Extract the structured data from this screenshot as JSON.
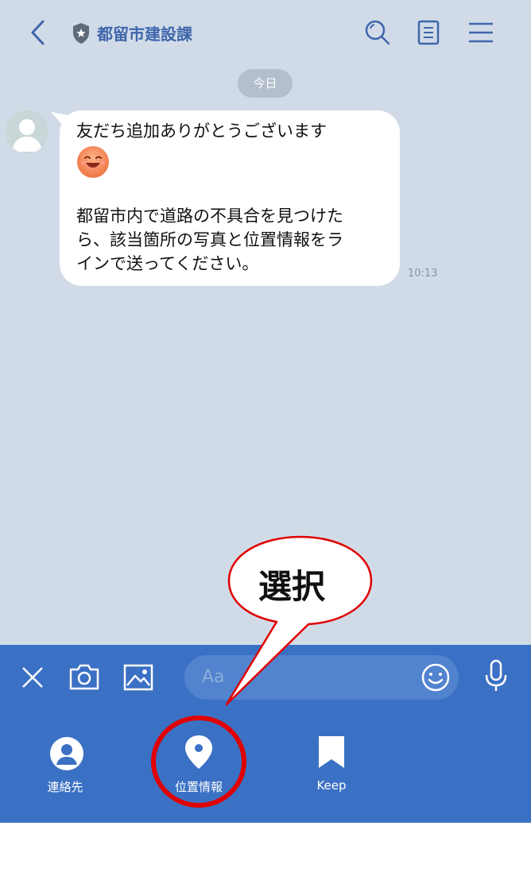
{
  "header": {
    "title": "都留市建設課"
  },
  "chat": {
    "date_label": "今日",
    "message": {
      "line1": "友だち追加ありがとうございます",
      "line2": "都留市内で道路の不具合を見つけた",
      "line3": "ら、該当箇所の写真と位置情報をラ",
      "line4": "インで送ってください。",
      "time": "10:13"
    }
  },
  "input": {
    "placeholder": "Aa"
  },
  "menu": {
    "items": [
      {
        "label": "連絡先"
      },
      {
        "label": "位置情報"
      },
      {
        "label": "Keep"
      }
    ]
  },
  "annotation": {
    "text": "選択"
  },
  "colors": {
    "header_accent": "#3f66ab",
    "chat_bg": "#d1dbe8",
    "toolbar_bg": "#3b71c4",
    "callout": "#e00000"
  }
}
